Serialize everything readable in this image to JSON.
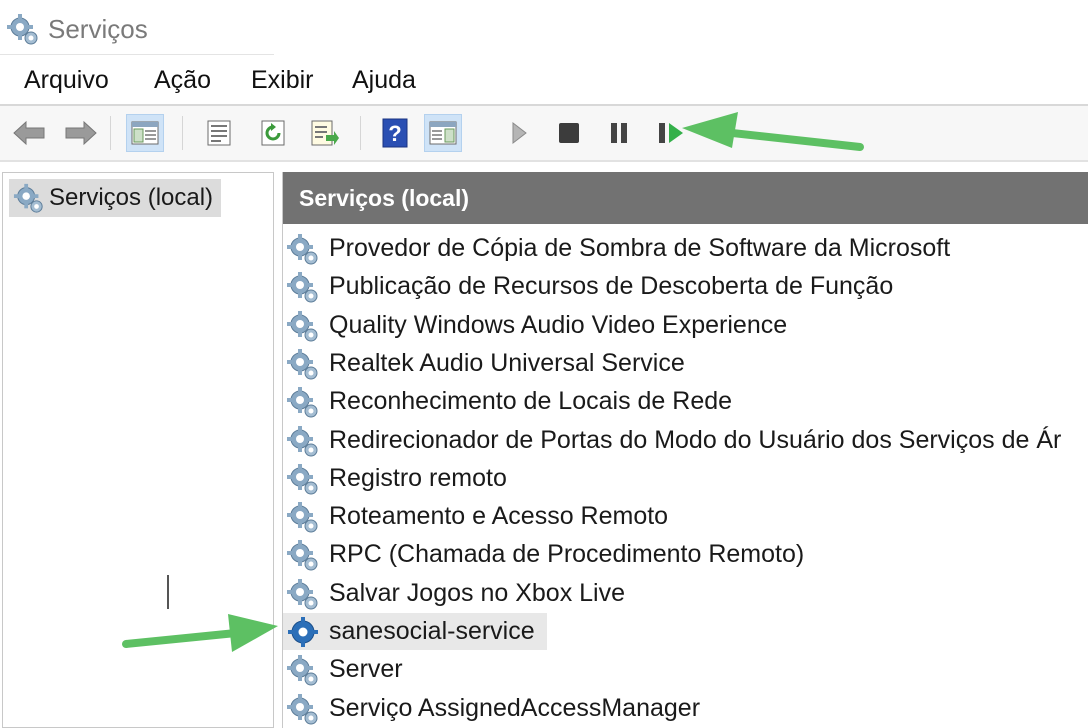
{
  "window": {
    "title": "Serviços"
  },
  "menu": {
    "items": [
      "Arquivo",
      "Ação",
      "Exibir",
      "Ajuda"
    ]
  },
  "toolbar": {
    "buttons": [
      "back-icon",
      "forward-icon",
      "show-hide-tree-icon",
      "properties-icon",
      "refresh-icon",
      "export-list-icon",
      "help-icon",
      "show-hide-action-pane-icon",
      "start-service-icon",
      "stop-service-icon",
      "pause-service-icon",
      "resume-service-icon"
    ]
  },
  "tree": {
    "root_label": "Serviços (local)"
  },
  "main": {
    "header": "Serviços (local)",
    "services": [
      "Provedor de Cópia de Sombra de Software da Microsoft",
      "Publicação de Recursos de Descoberta de Função",
      "Quality Windows Audio Video Experience",
      "Realtek Audio Universal Service",
      "Reconhecimento de Locais de Rede",
      "Redirecionador de Portas do Modo do Usuário dos Serviços de Ár",
      "Registro remoto",
      "Roteamento e Acesso Remoto",
      "RPC (Chamada de Procedimento Remoto)",
      "Salvar Jogos no Xbox Live",
      "sanesocial-service",
      "Server",
      "Serviço AssignedAccessManager"
    ],
    "selected_index": 10
  },
  "colors": {
    "annotation_arrow": "#5dc063",
    "header_bg": "#727272",
    "selection_bg": "#e8e8e8"
  }
}
